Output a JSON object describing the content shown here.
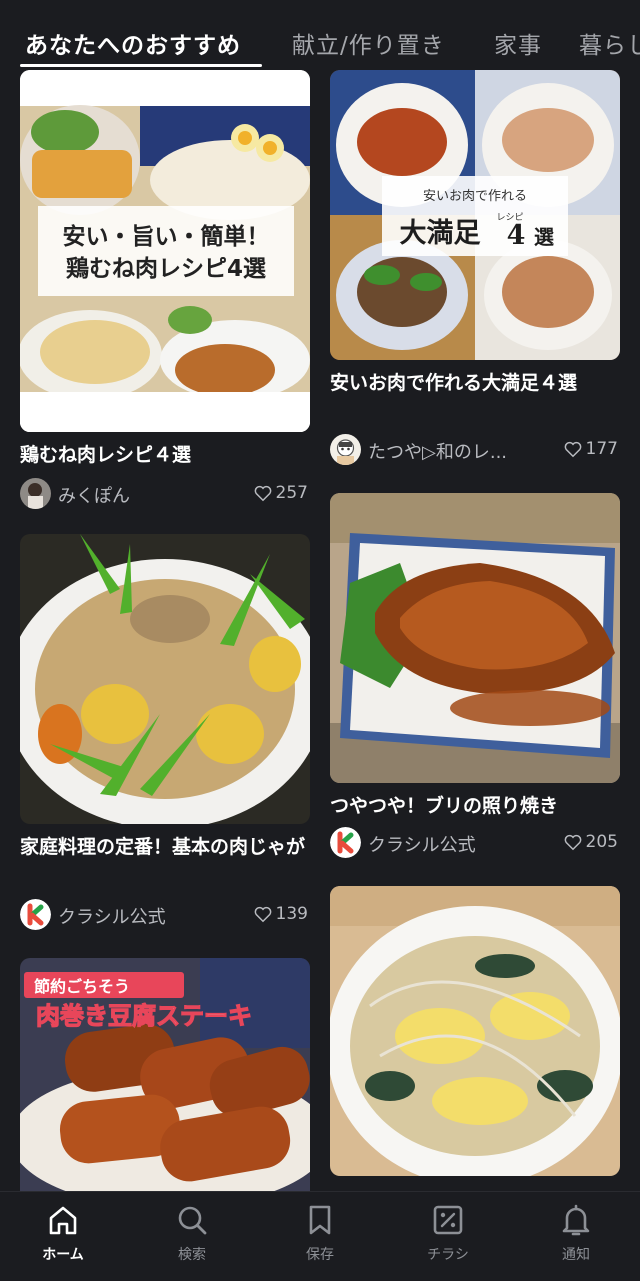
{
  "tabs": [
    {
      "label": "あなたへのおすすめ",
      "active": true
    },
    {
      "label": "献立/作り置き",
      "active": false
    },
    {
      "label": "家事",
      "active": false
    },
    {
      "label": "暮らし",
      "active": false
    }
  ],
  "cards": [
    {
      "title": "鶏むね肉レシピ４選",
      "author": "みくぽん",
      "likes": "257",
      "overlay_lines": [
        "安い・旨い・簡単！",
        "鶏むね肉レシピ4選"
      ]
    },
    {
      "title": "安いお肉で作れる大満足４選",
      "author": "たつや▷和のレ...",
      "likes": "177",
      "overlay_top": "安いお肉で作れる",
      "overlay_main": "大満足",
      "overlay_small": "レシピ",
      "overlay_num": "4",
      "overlay_end": "選"
    },
    {
      "title": "家庭料理の定番！基本の肉じゃが",
      "author": "クラシル公式",
      "likes": "139"
    },
    {
      "title": "つやつや！ブリの照り焼き",
      "author": "クラシル公式",
      "likes": "205"
    },
    {
      "title": "",
      "author": "",
      "likes": "",
      "overlay_top": "節約ごちそう",
      "overlay_main": "肉巻き豆腐ステーキ"
    },
    {
      "title": "",
      "author": "",
      "likes": ""
    }
  ],
  "nav": [
    {
      "label": "ホーム",
      "icon": "home-icon",
      "active": true
    },
    {
      "label": "検索",
      "icon": "search-icon",
      "active": false
    },
    {
      "label": "保存",
      "icon": "bookmark-icon",
      "active": false
    },
    {
      "label": "チラシ",
      "icon": "flyer-icon",
      "active": false
    },
    {
      "label": "通知",
      "icon": "bell-icon",
      "active": false
    }
  ],
  "colors": {
    "background": "#1b1c20",
    "text_primary": "#ffffff",
    "text_secondary": "#b9bbc0",
    "kurashiru_red": "#e94b3c",
    "kurashiru_green": "#27a349"
  }
}
